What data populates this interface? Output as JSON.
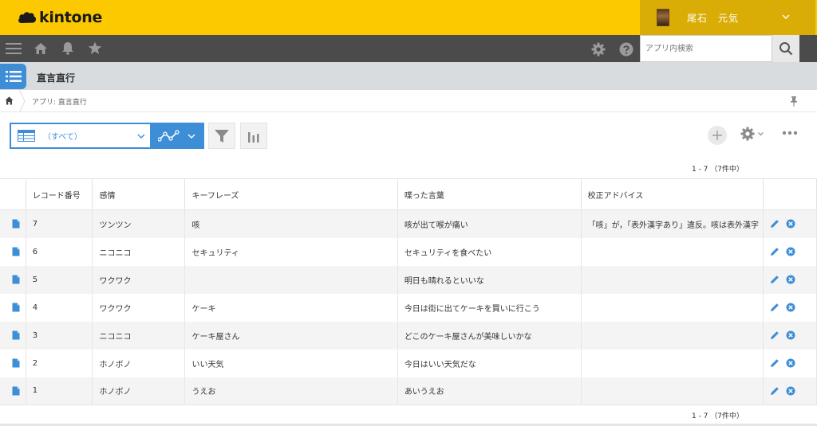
{
  "header": {
    "logo_text": "kintone",
    "user_name": "尾石　元気"
  },
  "nav": {
    "search_placeholder": "アプリ内検索"
  },
  "app": {
    "title": "直言直行",
    "breadcrumb": "アプリ: 直言直行"
  },
  "toolbar": {
    "view_label": "（すべて）"
  },
  "pager": {
    "top": "1 - 7 （7件中）",
    "bottom": "1 - 7 （7件中）"
  },
  "table": {
    "columns": [
      "レコード番号",
      "感情",
      "キーフレーズ",
      "喋った言葉",
      "校正アドバイス"
    ],
    "rows": [
      [
        "7",
        "ツンツン",
        "咳",
        "咳が出て喉が痛い",
        "「咳」が，「表外漢字あり」違反。咳は表外漢字"
      ],
      [
        "6",
        "ニコニコ",
        "セキュリティ",
        "セキュリティを食べたい",
        ""
      ],
      [
        "5",
        "ワクワク",
        "",
        "明日も晴れるといいな",
        ""
      ],
      [
        "4",
        "ワクワク",
        "ケーキ",
        "今日は街に出てケーキを買いに行こう",
        ""
      ],
      [
        "3",
        "ニコニコ",
        "ケーキ屋さん",
        "どこのケーキ屋さんが美味しいかな",
        ""
      ],
      [
        "2",
        "ホノボノ",
        "いい天気",
        "今日はいい天気だな",
        ""
      ],
      [
        "1",
        "ホノボノ",
        "うえお",
        "あいうえお",
        ""
      ]
    ]
  },
  "colors": {
    "brand_yellow": "#fcc800",
    "nav_dark": "#4b4b4b",
    "accent_blue": "#3d8ed6"
  }
}
